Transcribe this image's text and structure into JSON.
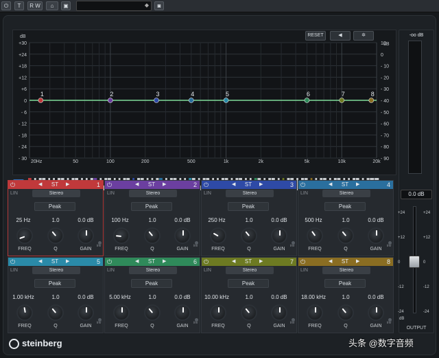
{
  "topbar": {
    "buttons": [
      {
        "icon": "power-icon",
        "label": "⏻"
      },
      {
        "icon": "toggle-icon",
        "label": "T"
      },
      {
        "icon": "read-write-icon",
        "label": "R W"
      },
      {
        "icon": "settings-icon",
        "label": "⌂"
      },
      {
        "icon": "window-icon",
        "label": "▣"
      }
    ]
  },
  "graph": {
    "reset_label": "RESET",
    "speaker_icon": "speaker-icon",
    "gear_icon": "gear-icon",
    "left_unit": "dB",
    "right_unit": "dB",
    "left_scale": [
      "+30",
      "+24",
      "+18",
      "+12",
      "+6",
      "0",
      "- 6",
      "- 12",
      "- 18",
      "- 24",
      "- 30"
    ],
    "right_scale": [
      "10",
      "0",
      "- 10",
      "- 20",
      "- 30",
      "- 40",
      "- 50",
      "- 60",
      "- 70",
      "- 80",
      "- 90"
    ],
    "freq_labels": [
      "20Hz",
      "50",
      "100",
      "200",
      "500",
      "1k",
      "2k",
      "5k",
      "10k",
      "20k"
    ],
    "node_labels": [
      "1",
      "2",
      "3",
      "4",
      "5",
      "6",
      "7",
      "8"
    ],
    "curve_color": "#7fdc9a"
  },
  "bands": [
    {
      "num": "1",
      "color": "#c0393b",
      "st": "ST",
      "lin": "LIN",
      "stereo": "Stereo",
      "type": "Peak",
      "freq": "25 Hz",
      "q": "1.0",
      "gain": "0.0 dB"
    },
    {
      "num": "2",
      "color": "#6b3fa0",
      "st": "ST",
      "lin": "LIN",
      "stereo": "Stereo",
      "type": "Peak",
      "freq": "100 Hz",
      "q": "1.0",
      "gain": "0.0 dB"
    },
    {
      "num": "3",
      "color": "#2e4aa6",
      "st": "ST",
      "lin": "LIN",
      "stereo": "Stereo",
      "type": "Peak",
      "freq": "250 Hz",
      "q": "1.0",
      "gain": "0.0 dB"
    },
    {
      "num": "4",
      "color": "#2a6f9e",
      "st": "ST",
      "lin": "LIN",
      "stereo": "Stereo",
      "type": "Peak",
      "freq": "500 Hz",
      "q": "1.0",
      "gain": "0.0 dB"
    },
    {
      "num": "5",
      "color": "#2a8aa8",
      "st": "ST",
      "lin": "LIN",
      "stereo": "Stereo",
      "type": "Peak",
      "freq": "1.00 kHz",
      "q": "1.0",
      "gain": "0.0 dB"
    },
    {
      "num": "6",
      "color": "#2f8a5a",
      "st": "ST",
      "lin": "LIN",
      "stereo": "Stereo",
      "type": "Peak",
      "freq": "5.00 kHz",
      "q": "1.0",
      "gain": "0.0 dB"
    },
    {
      "num": "7",
      "color": "#6d7a22",
      "st": "ST",
      "lin": "LIN",
      "stereo": "Stereo",
      "type": "Peak",
      "freq": "10.00 kHz",
      "q": "1.0",
      "gain": "0.0 dB"
    },
    {
      "num": "8",
      "color": "#8a6d22",
      "st": "ST",
      "lin": "LIN",
      "stereo": "Stereo",
      "type": "Peak",
      "freq": "18.00 kHz",
      "q": "1.0",
      "gain": "0.0 dB"
    }
  ],
  "knob_labels": {
    "freq": "FREQ",
    "q": "Q",
    "gain": "GAIN",
    "inv": "inv"
  },
  "output": {
    "peak": "-oo dB",
    "value": "0.0 dB",
    "label": "OUTPUT",
    "scale_left": [
      "+24",
      "+12",
      "0",
      "-12",
      "-24"
    ],
    "scale_right": [
      "+24",
      "+12",
      "0",
      "-12",
      "-24"
    ],
    "db_unit": "dB"
  },
  "footer": {
    "brand": "steinberg"
  },
  "watermark": "头条 @数字音频"
}
